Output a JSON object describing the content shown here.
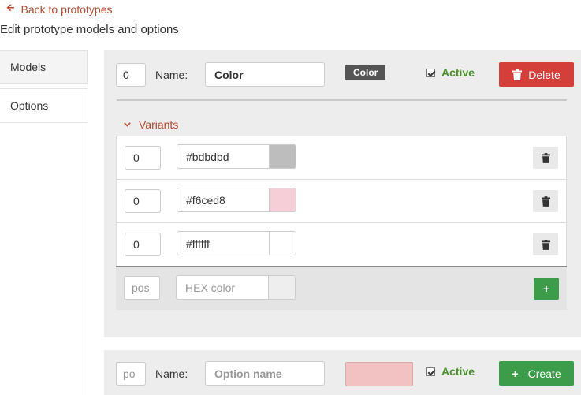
{
  "header": {
    "back_label": "Back to prototypes",
    "subtitle": "Edit prototype models and options"
  },
  "sidebar": {
    "items": [
      {
        "label": "Models",
        "active": false
      },
      {
        "label": "Options",
        "active": true
      }
    ]
  },
  "option": {
    "position": "0",
    "name_label": "Name:",
    "name_value": "Color",
    "badge": "Color",
    "active_label": "Active",
    "active_checked": true,
    "delete_label": "Delete",
    "variants_label": "Variants",
    "variants": [
      {
        "position": "0",
        "hex": "#bdbdbd"
      },
      {
        "position": "0",
        "hex": "#f6ced8"
      },
      {
        "position": "0",
        "hex": "#ffffff"
      }
    ],
    "new_variant": {
      "position_placeholder": "pos",
      "hex_placeholder": "HEX color",
      "add_label": "+"
    }
  },
  "new_option": {
    "position_placeholder": "po",
    "name_label": "Name:",
    "name_placeholder": "Option name",
    "active_label": "Active",
    "active_checked": true,
    "create_label": "Create",
    "preview_color": "#f2c2c2"
  },
  "colors": {
    "accent_link": "#b24a2f",
    "danger": "#d43f3a",
    "success": "#3c9c4a",
    "active_text": "#4a8f2b"
  }
}
